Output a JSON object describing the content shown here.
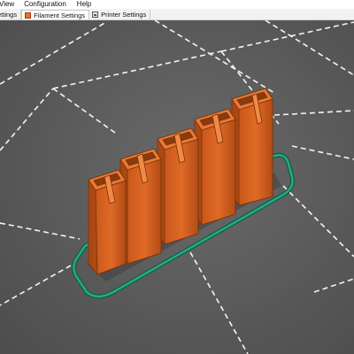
{
  "menubar": {
    "items": [
      {
        "label": "View"
      },
      {
        "label": "Configuration"
      },
      {
        "label": "Help"
      }
    ]
  },
  "tabs": [
    {
      "label": "ettings"
    },
    {
      "label": "Filament Settings"
    },
    {
      "label": "Printer Settings"
    }
  ],
  "colors": {
    "bed": "#5a5a5a",
    "grid_lines": "#f4f4f4",
    "model": "#d9611e",
    "model_shadow": "#a24414",
    "skirt": "#1d8a6a",
    "skirt_dark": "#0d5f47"
  },
  "icons": {
    "filament_tab": "filament-spool-icon",
    "printer_tab": "printer-icon"
  }
}
